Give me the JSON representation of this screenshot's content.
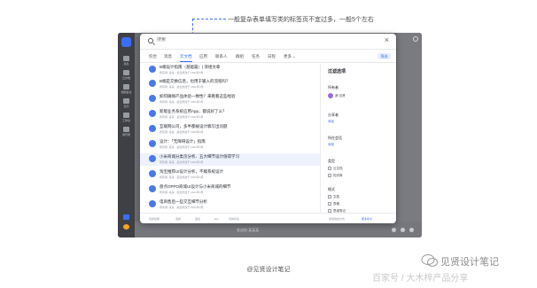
{
  "annotation": {
    "text": "一般复杂表单填写类的标签页不宜过多，一般5个左右"
  },
  "sidebar": {
    "labels": [
      "消息",
      "云文档",
      "视频会议",
      "日历",
      "工作台",
      "通讯录"
    ]
  },
  "search": {
    "placeholder": "搜索"
  },
  "tabs": [
    "综合",
    "消息",
    "云文档",
    "应用",
    "联系人",
    "群组",
    "任务",
    "日程",
    "更多"
  ],
  "tabs_more_suffix": "⌄",
  "active_tab": "云文档",
  "filter_button": "筛选",
  "results": [
    {
      "title": "B端设计指南（基础篇）| 译组文章",
      "meta": "所有者: 某某 · 最近修改于 2021年3月"
    },
    {
      "title": "B端是交换信息，也用于输入的流程吗？",
      "meta": "所有者: 某某 · 最近修改于 2021年3月"
    },
    {
      "title": "如何确保产品体验一致性？来看看这些经验",
      "meta": "所有者: 某某 · 最近修改于 2021年3月"
    },
    {
      "title": "新版业务系统应用App，都说好了么？",
      "meta": "所有者: 某某 · 最近修改于 2021年3月"
    },
    {
      "title": "互联网公司，多半都被设计稿写出问题",
      "meta": "所有者: 某某 · 最近修改于 2021年3月"
    },
    {
      "title": "设计：「无障碍设计」指南",
      "meta": "所有者: 某某 · 最近修改于 2021年3月"
    },
    {
      "title": "小米商城分类页分析、五大细节设计值得学习",
      "meta": "所有者: 某某 · 最近修改于 2021年3月"
    },
    {
      "title": "淘宝推荐UI设计分析，不端系统设计",
      "meta": "所有者: 某某 · 最近修改于 2021年3月"
    },
    {
      "title": "盘点OPPO商城UI设计与小米商城的细节",
      "meta": "所有者: 某某 · 最近修改于 2021年3月"
    },
    {
      "title": "电商售后一些交互细节分析",
      "meta": "所有者: 某某 · 最近修改于 2021年3月"
    }
  ],
  "filter_panel": {
    "title": "过滤选项",
    "owner_label": "所有者",
    "owner_chip": "我·见贤",
    "sharer_label": "分享者",
    "sharer_add": "添加",
    "group_label": "所在会话",
    "group_add": "添加",
    "type_label": "类型",
    "types": [
      "云文档",
      "知识库"
    ],
    "format_label": "格式",
    "formats": [
      "文档",
      "表格",
      "思维笔记"
    ]
  },
  "footer": {
    "hints": [
      "切换结果",
      "选择",
      "退出",
      "Esc",
      "切换标签"
    ],
    "right_1": "使用快捷方式",
    "right_2": "更多命令"
  },
  "bottom_bar": {
    "placeholder": "发送给 某某某"
  },
  "caption": "@见贤设计笔记",
  "watermark": {
    "name": "见贤设计笔记",
    "sub": "百家号 / 大木梓产品分享"
  },
  "colors": {
    "accent": "#3b6ef5",
    "annotation_line": "#3b6ef5"
  }
}
